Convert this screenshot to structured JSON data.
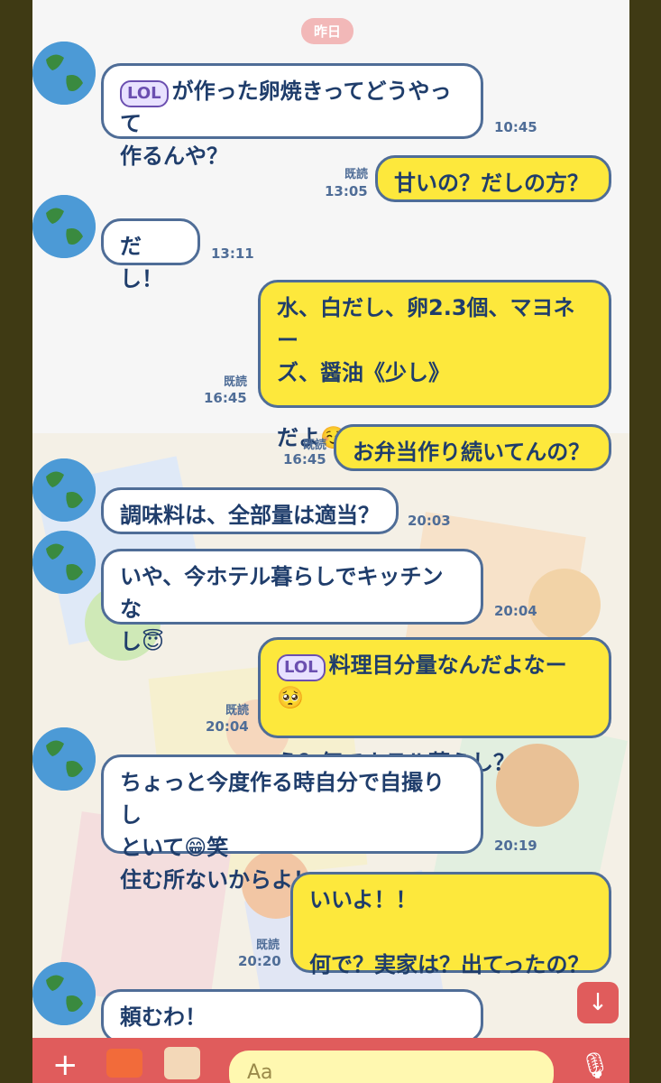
{
  "date_chip": "昨日",
  "messages": [
    {
      "side": "in",
      "lines": [
        "が作った卵焼きってどうやって",
        "作るんや？"
      ],
      "badge": "LOL",
      "time": "10:45"
    },
    {
      "side": "out",
      "lines": [
        "甘いの？だしの方？"
      ],
      "read": "既読",
      "time": "13:05"
    },
    {
      "side": "in",
      "lines": [
        "だし！"
      ],
      "time": "13:11"
    },
    {
      "side": "out",
      "lines": [
        "水、白だし、卵2.3個、マヨネー",
        "ズ、醤油《少し》",
        "",
        "だよ☺️"
      ],
      "read": "既読",
      "time": "16:45"
    },
    {
      "side": "out",
      "lines": [
        "お弁当作り続いてんの？"
      ],
      "read": "既読",
      "time": "16:45"
    },
    {
      "side": "in",
      "lines": [
        "調味料は、全部量は適当？"
      ],
      "time": "20:03"
    },
    {
      "side": "in",
      "lines": [
        "いや、今ホテル暮らしでキッチンな",
        "し😇"
      ],
      "time": "20:04"
    },
    {
      "side": "out",
      "lines": [
        "料理目分量なんだよなー🥺",
        "",
        "え？何でホテル暮らし？"
      ],
      "badge": "LOL",
      "read": "既読",
      "time": "20:04"
    },
    {
      "side": "in",
      "lines": [
        "ちょっと今度作る時自分で自撮りし",
        "といて😁笑",
        "住む所ないからよ！"
      ],
      "time": "20:19"
    },
    {
      "side": "out",
      "lines": [
        "いいよ！！",
        "",
        "何で？実家は？出てったの？"
      ],
      "read": "既読",
      "time": "20:20"
    },
    {
      "side": "in",
      "lines": [
        "頼むわ！"
      ],
      "time": ""
    }
  ],
  "input": {
    "placeholder": "Aa"
  },
  "icons": {
    "plus": "plus-icon",
    "camera": "camera-icon",
    "image": "image-icon",
    "mic": "mic-icon",
    "scroll": "arrow-down-icon"
  }
}
